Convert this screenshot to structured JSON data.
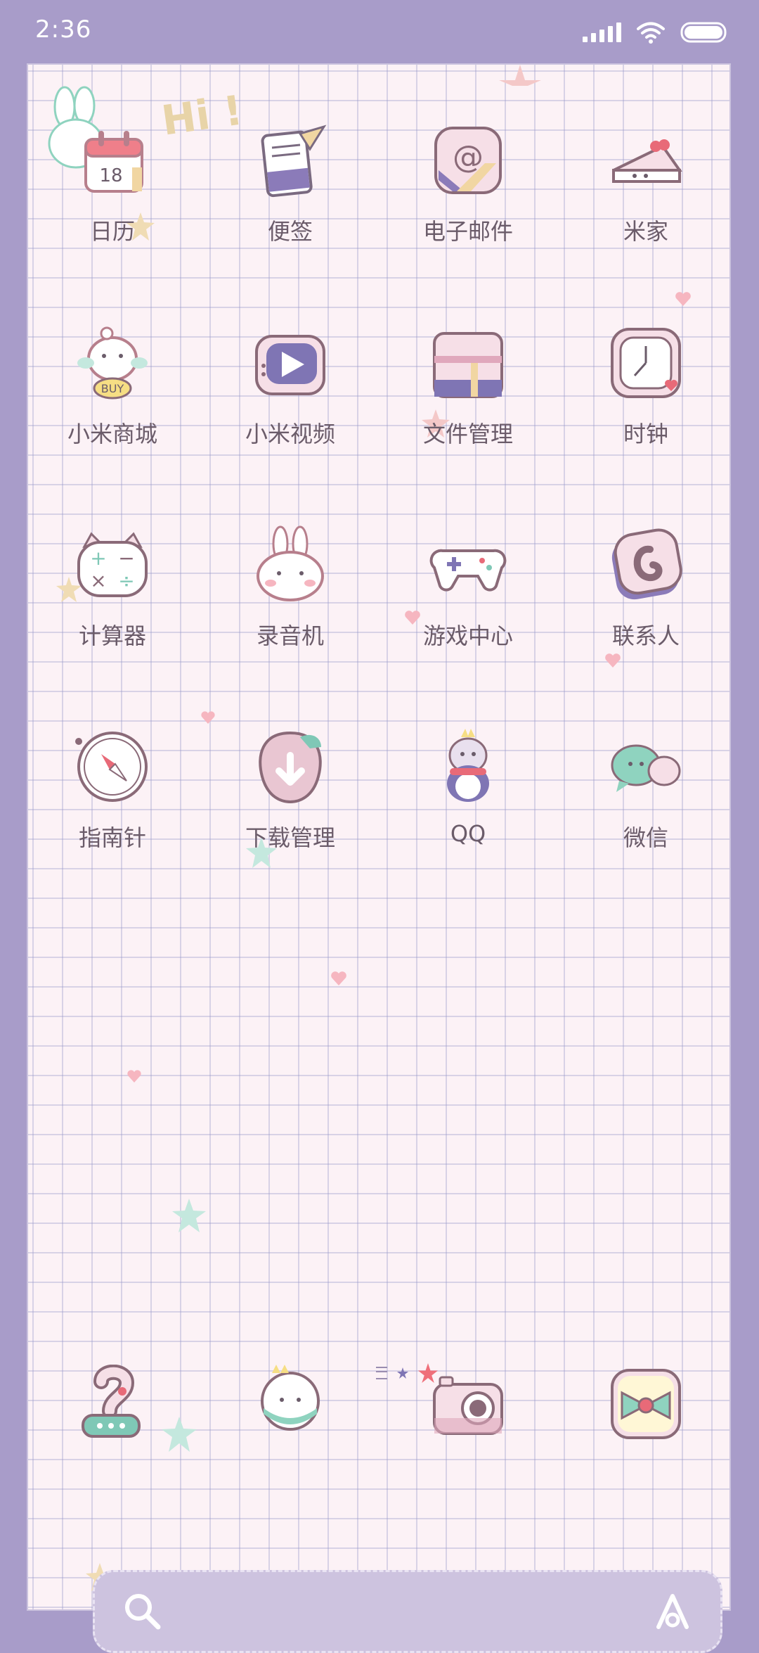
{
  "status_bar": {
    "time": "2:36"
  },
  "wallpaper": {
    "greeting": "Hi !"
  },
  "apps": [
    {
      "label": "日历",
      "icon": "calendar-icon",
      "badge": "18"
    },
    {
      "label": "便签",
      "icon": "notes-icon"
    },
    {
      "label": "电子邮件",
      "icon": "email-icon"
    },
    {
      "label": "米家",
      "icon": "cake-icon"
    },
    {
      "label": "小米商城",
      "icon": "shop-chick-icon",
      "badge": "BUY"
    },
    {
      "label": "小米视频",
      "icon": "video-icon"
    },
    {
      "label": "文件管理",
      "icon": "folder-icon"
    },
    {
      "label": "时钟",
      "icon": "clock-icon"
    },
    {
      "label": "计算器",
      "icon": "calculator-icon"
    },
    {
      "label": "录音机",
      "icon": "bunny-recorder-icon"
    },
    {
      "label": "游戏中心",
      "icon": "gamepad-icon"
    },
    {
      "label": "联系人",
      "icon": "contacts-icon"
    },
    {
      "label": "指南针",
      "icon": "compass-icon"
    },
    {
      "label": "下载管理",
      "icon": "download-icon"
    },
    {
      "label": "QQ",
      "icon": "penguin-icon"
    },
    {
      "label": "微信",
      "icon": "chat-bubbles-icon"
    }
  ],
  "dock": [
    {
      "icon": "phone-icon"
    },
    {
      "icon": "messages-icon"
    },
    {
      "icon": "camera-icon"
    },
    {
      "icon": "browser-icon"
    }
  ],
  "colors": {
    "frame": "#a89cc9",
    "paper": "#fcf2f6",
    "label": "#6b5c6a",
    "accent_pink": "#e89aa6",
    "accent_mint": "#8fd3bf",
    "accent_purple": "#7f75b4"
  }
}
